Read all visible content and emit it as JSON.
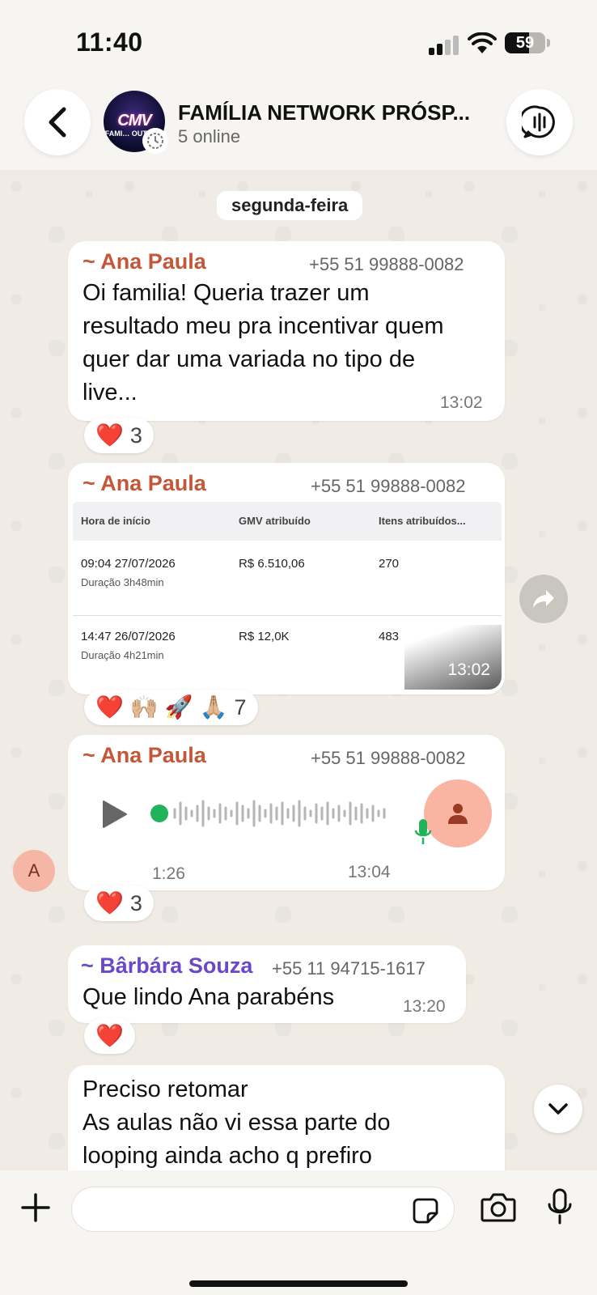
{
  "status_bar": {
    "time": "11:40",
    "battery": "59"
  },
  "header": {
    "group_name": "FAMÍLIA NETWORK PRÓSP...",
    "status": "5 online",
    "avatar_text": "CMV",
    "avatar_sub": "FAMI… OUTLE…"
  },
  "date_divider": "segunda-feira",
  "messages": [
    {
      "sender": "~ Ana Paula",
      "phone": "+55 51 99888-0082",
      "text_lines": [
        "Oi familia! Queria trazer um",
        "resultado meu pra incentivar quem",
        "quer dar uma variada no tipo de",
        "live..."
      ],
      "time": "13:02",
      "reaction_count": "3"
    },
    {
      "sender": "~ Ana Paula",
      "phone": "+55 51 99888-0082",
      "table": {
        "headers": [
          "Hora de início",
          "GMV atribuído",
          "Itens atribuídos..."
        ],
        "rows": [
          {
            "start": "09:04 27/07/2026",
            "duration": "Duração 3h48min",
            "gmv": "R$ 6.510,06",
            "items": "270"
          },
          {
            "start": "14:47 26/07/2026",
            "duration": "Duração 4h21min",
            "gmv": "R$ 12,0K",
            "items": "483"
          }
        ]
      },
      "time": "13:02",
      "reaction_count": "7"
    },
    {
      "sender": "~ Ana Paula",
      "phone": "+55 51 99888-0082",
      "voice_duration": "1:26",
      "time": "13:04",
      "reaction_count": "3",
      "avatar_letter": "A"
    },
    {
      "sender": "~ Bârbára Souza",
      "phone": "+55 11 94715-1617",
      "text": "Que lindo Ana parabéns",
      "time": "13:20"
    },
    {
      "text_lines": [
        "Preciso retomar",
        "As aulas não vi essa parte do",
        "looping ainda acho q prefiro"
      ]
    }
  ],
  "composer": {
    "placeholder": ""
  },
  "colors": {
    "sender_orange": "#c2573a",
    "sender_purple": "#6a48c8",
    "voice_green": "#21b35a"
  }
}
